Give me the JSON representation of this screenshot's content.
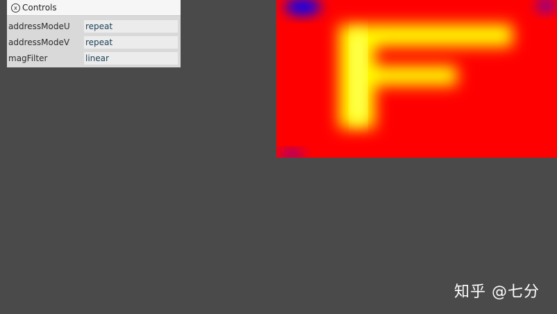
{
  "panel": {
    "close_glyph": "x",
    "title": "Controls",
    "rows": [
      {
        "label": "addressModeU",
        "value": "repeat"
      },
      {
        "label": "addressModeV",
        "value": "repeat"
      },
      {
        "label": "magFilter",
        "value": "linear"
      }
    ]
  },
  "canvas": {
    "texture_letter": "F",
    "colors": {
      "background": "#ff0000",
      "letter": "#ffff00",
      "corner": "#0000ff"
    }
  },
  "watermark": {
    "text": "知乎 @七分"
  },
  "colors": {
    "page_background": "#4a4a4a",
    "panel_background": "#d9d9d9",
    "value_text": "#1d4258"
  }
}
